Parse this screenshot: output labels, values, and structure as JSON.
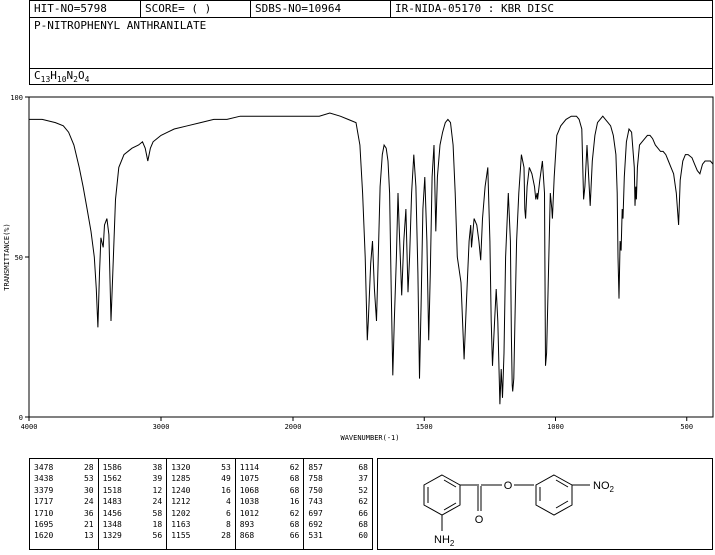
{
  "header": {
    "hit_no": "HIT-NO=5798",
    "score": "SCORE=  (   )",
    "sdbs_no": "SDBS-NO=10964",
    "ir_code": "IR-NIDA-05170 : KBR DISC",
    "compound_name": "P-NITROPHENYL ANTHRANILATE",
    "formula": {
      "c": "C",
      "c_n": "13",
      "h": "H",
      "h_n": "10",
      "n": "N",
      "n_n": "2",
      "o": "O",
      "o_n": "4"
    }
  },
  "chart_data": {
    "type": "line",
    "title": "",
    "xlabel": "WAVENUMBER(-1)",
    "ylabel": "TRANSMITTANCE(%)",
    "xlim": [
      4000,
      400
    ],
    "ylim": [
      0,
      100
    ],
    "x_inverted": true,
    "x_ticks": [
      "4000",
      "3000",
      "2000",
      "1500",
      "1000",
      "500"
    ],
    "y_ticks": [
      "0",
      "50",
      "100"
    ],
    "series": [
      {
        "points": [
          [
            4000,
            93
          ],
          [
            3900,
            93
          ],
          [
            3800,
            92
          ],
          [
            3740,
            91
          ],
          [
            3700,
            89
          ],
          [
            3660,
            85
          ],
          [
            3620,
            78
          ],
          [
            3590,
            72
          ],
          [
            3560,
            65
          ],
          [
            3530,
            58
          ],
          [
            3505,
            50
          ],
          [
            3490,
            40
          ],
          [
            3478,
            28
          ],
          [
            3466,
            45
          ],
          [
            3455,
            56
          ],
          [
            3438,
            53
          ],
          [
            3428,
            60
          ],
          [
            3410,
            62
          ],
          [
            3395,
            57
          ],
          [
            3379,
            30
          ],
          [
            3365,
            45
          ],
          [
            3345,
            68
          ],
          [
            3320,
            78
          ],
          [
            3280,
            82
          ],
          [
            3220,
            84
          ],
          [
            3170,
            85
          ],
          [
            3140,
            86
          ],
          [
            3120,
            84
          ],
          [
            3100,
            80
          ],
          [
            3080,
            84
          ],
          [
            3060,
            86
          ],
          [
            3030,
            87
          ],
          [
            3000,
            88
          ],
          [
            2950,
            89
          ],
          [
            2900,
            90
          ],
          [
            2800,
            91
          ],
          [
            2700,
            92
          ],
          [
            2600,
            93
          ],
          [
            2500,
            93
          ],
          [
            2400,
            94
          ],
          [
            2300,
            94
          ],
          [
            2200,
            94
          ],
          [
            2100,
            94
          ],
          [
            2000,
            94
          ],
          [
            1900,
            94
          ],
          [
            1860,
            95
          ],
          [
            1820,
            94
          ],
          [
            1790,
            93
          ],
          [
            1760,
            92
          ],
          [
            1745,
            85
          ],
          [
            1735,
            70
          ],
          [
            1725,
            50
          ],
          [
            1717,
            24
          ],
          [
            1713,
            30
          ],
          [
            1710,
            36
          ],
          [
            1704,
            48
          ],
          [
            1697,
            55
          ],
          [
            1690,
            40
          ],
          [
            1682,
            30
          ],
          [
            1676,
            48
          ],
          [
            1668,
            72
          ],
          [
            1660,
            82
          ],
          [
            1653,
            85
          ],
          [
            1645,
            84
          ],
          [
            1638,
            80
          ],
          [
            1632,
            70
          ],
          [
            1626,
            40
          ],
          [
            1620,
            13
          ],
          [
            1614,
            30
          ],
          [
            1606,
            50
          ],
          [
            1600,
            70
          ],
          [
            1596,
            60
          ],
          [
            1586,
            38
          ],
          [
            1578,
            55
          ],
          [
            1570,
            65
          ],
          [
            1562,
            39
          ],
          [
            1556,
            50
          ],
          [
            1548,
            70
          ],
          [
            1540,
            82
          ],
          [
            1532,
            72
          ],
          [
            1524,
            45
          ],
          [
            1518,
            12
          ],
          [
            1512,
            35
          ],
          [
            1505,
            65
          ],
          [
            1498,
            75
          ],
          [
            1490,
            55
          ],
          [
            1483,
            24
          ],
          [
            1477,
            45
          ],
          [
            1470,
            75
          ],
          [
            1463,
            85
          ],
          [
            1456,
            58
          ],
          [
            1450,
            75
          ],
          [
            1440,
            85
          ],
          [
            1430,
            89
          ],
          [
            1420,
            92
          ],
          [
            1410,
            93
          ],
          [
            1400,
            92
          ],
          [
            1390,
            85
          ],
          [
            1382,
            70
          ],
          [
            1374,
            50
          ],
          [
            1360,
            42
          ],
          [
            1348,
            18
          ],
          [
            1340,
            35
          ],
          [
            1329,
            55
          ],
          [
            1323,
            60
          ],
          [
            1320,
            53
          ],
          [
            1310,
            62
          ],
          [
            1300,
            60
          ],
          [
            1292,
            55
          ],
          [
            1285,
            49
          ],
          [
            1278,
            62
          ],
          [
            1268,
            72
          ],
          [
            1258,
            78
          ],
          [
            1250,
            55
          ],
          [
            1245,
            30
          ],
          [
            1240,
            16
          ],
          [
            1232,
            30
          ],
          [
            1226,
            40
          ],
          [
            1220,
            30
          ],
          [
            1212,
            4
          ],
          [
            1207,
            15
          ],
          [
            1202,
            6
          ],
          [
            1196,
            20
          ],
          [
            1190,
            50
          ],
          [
            1180,
            70
          ],
          [
            1172,
            55
          ],
          [
            1168,
            25
          ],
          [
            1165,
            10
          ],
          [
            1163,
            8
          ],
          [
            1159,
            12
          ],
          [
            1155,
            28
          ],
          [
            1148,
            55
          ],
          [
            1140,
            70
          ],
          [
            1130,
            82
          ],
          [
            1120,
            78
          ],
          [
            1117,
            65
          ],
          [
            1114,
            62
          ],
          [
            1108,
            72
          ],
          [
            1100,
            78
          ],
          [
            1090,
            76
          ],
          [
            1080,
            72
          ],
          [
            1075,
            68
          ],
          [
            1070,
            70
          ],
          [
            1068,
            68
          ],
          [
            1060,
            74
          ],
          [
            1050,
            80
          ],
          [
            1042,
            70
          ],
          [
            1038,
            16
          ],
          [
            1034,
            20
          ],
          [
            1028,
            40
          ],
          [
            1020,
            70
          ],
          [
            1014,
            65
          ],
          [
            1012,
            62
          ],
          [
            1005,
            75
          ],
          [
            995,
            88
          ],
          [
            980,
            91
          ],
          [
            960,
            93
          ],
          [
            940,
            94
          ],
          [
            920,
            94
          ],
          [
            910,
            93
          ],
          [
            900,
            90
          ],
          [
            893,
            68
          ],
          [
            888,
            72
          ],
          [
            880,
            85
          ],
          [
            868,
            66
          ],
          [
            860,
            80
          ],
          [
            850,
            88
          ],
          [
            840,
            92
          ],
          [
            830,
            93
          ],
          [
            820,
            94
          ],
          [
            810,
            93
          ],
          [
            800,
            92
          ],
          [
            790,
            91
          ],
          [
            780,
            88
          ],
          [
            770,
            82
          ],
          [
            765,
            70
          ],
          [
            762,
            50
          ],
          [
            758,
            37
          ],
          [
            754,
            55
          ],
          [
            750,
            52
          ],
          [
            746,
            65
          ],
          [
            743,
            62
          ],
          [
            738,
            75
          ],
          [
            730,
            86
          ],
          [
            720,
            90
          ],
          [
            710,
            89
          ],
          [
            700,
            78
          ],
          [
            697,
            66
          ],
          [
            694,
            72
          ],
          [
            692,
            68
          ],
          [
            688,
            78
          ],
          [
            680,
            85
          ],
          [
            670,
            86
          ],
          [
            660,
            87
          ],
          [
            650,
            88
          ],
          [
            640,
            88
          ],
          [
            630,
            87
          ],
          [
            620,
            85
          ],
          [
            610,
            84
          ],
          [
            600,
            83
          ],
          [
            590,
            83
          ],
          [
            580,
            82
          ],
          [
            570,
            80
          ],
          [
            560,
            78
          ],
          [
            550,
            76
          ],
          [
            540,
            70
          ],
          [
            531,
            60
          ],
          [
            525,
            74
          ],
          [
            515,
            80
          ],
          [
            505,
            82
          ],
          [
            495,
            82
          ],
          [
            480,
            81
          ],
          [
            470,
            79
          ],
          [
            460,
            77
          ],
          [
            450,
            76
          ],
          [
            440,
            79
          ],
          [
            430,
            80
          ],
          [
            420,
            80
          ],
          [
            410,
            80
          ],
          [
            400,
            79
          ]
        ]
      }
    ]
  },
  "peak_table": [
    [
      [
        "3478",
        "28"
      ],
      [
        "3438",
        "53"
      ],
      [
        "3379",
        "30"
      ],
      [
        "1717",
        "24"
      ],
      [
        "1710",
        "36"
      ],
      [
        "1695",
        "21"
      ],
      [
        "1620",
        "13"
      ]
    ],
    [
      [
        "1586",
        "38"
      ],
      [
        "1562",
        "39"
      ],
      [
        "1518",
        "12"
      ],
      [
        "1483",
        "24"
      ],
      [
        "1456",
        "58"
      ],
      [
        "1348",
        "18"
      ],
      [
        "1329",
        "56"
      ]
    ],
    [
      [
        "1320",
        "53"
      ],
      [
        "1285",
        "49"
      ],
      [
        "1240",
        "16"
      ],
      [
        "1212",
        "4"
      ],
      [
        "1202",
        "6"
      ],
      [
        "1163",
        "8"
      ],
      [
        "1155",
        "28"
      ]
    ],
    [
      [
        "1114",
        "62"
      ],
      [
        "1075",
        "68"
      ],
      [
        "1068",
        "68"
      ],
      [
        "1038",
        "16"
      ],
      [
        "1012",
        "62"
      ],
      [
        "893",
        "68"
      ],
      [
        "868",
        "66"
      ]
    ],
    [
      [
        "857",
        "68"
      ],
      [
        "758",
        "37"
      ],
      [
        "750",
        "52"
      ],
      [
        "743",
        "62"
      ],
      [
        "697",
        "66"
      ],
      [
        "692",
        "68"
      ],
      [
        "531",
        "60"
      ]
    ]
  ],
  "structure": {
    "o_label": "O",
    "no2_label": "NO",
    "no2_sub": "2",
    "carbonyl_o": "O",
    "nh2_label": "NH",
    "nh2_sub": "2"
  }
}
